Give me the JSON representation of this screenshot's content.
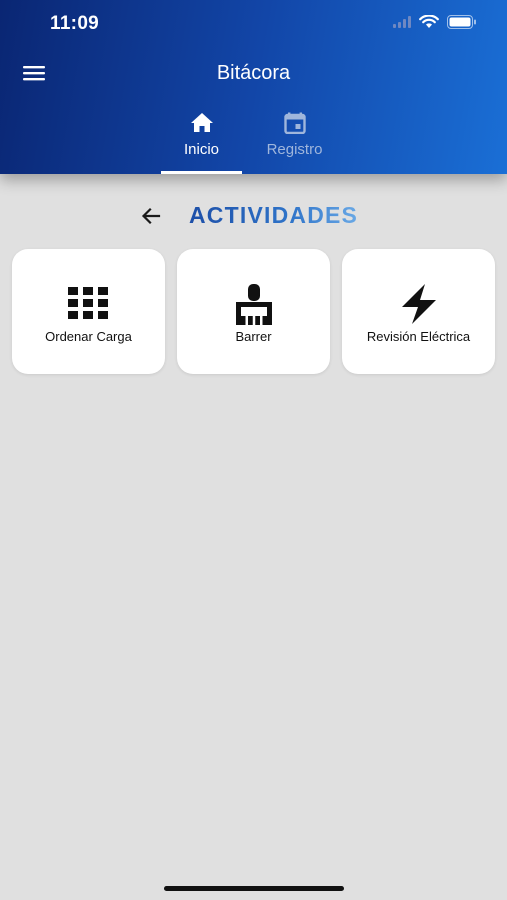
{
  "status_bar": {
    "time": "11:09"
  },
  "header": {
    "title": "Bitácora",
    "tabs": [
      {
        "label": "Inicio",
        "icon": "home-icon",
        "active": true
      },
      {
        "label": "Registro",
        "icon": "calendar-icon",
        "active": false
      }
    ]
  },
  "section": {
    "title": "ACTIVIDADES"
  },
  "activities": [
    {
      "label": "Ordenar Carga",
      "icon": "grid-icon"
    },
    {
      "label": "Barrer",
      "icon": "broom-icon"
    },
    {
      "label": "Revisión Eléctrica",
      "icon": "lightning-icon"
    }
  ],
  "colors": {
    "header_start": "#0a2673",
    "header_end": "#1a6fd6",
    "background": "#e0e0e0",
    "title_accent": "#2f74c9"
  }
}
